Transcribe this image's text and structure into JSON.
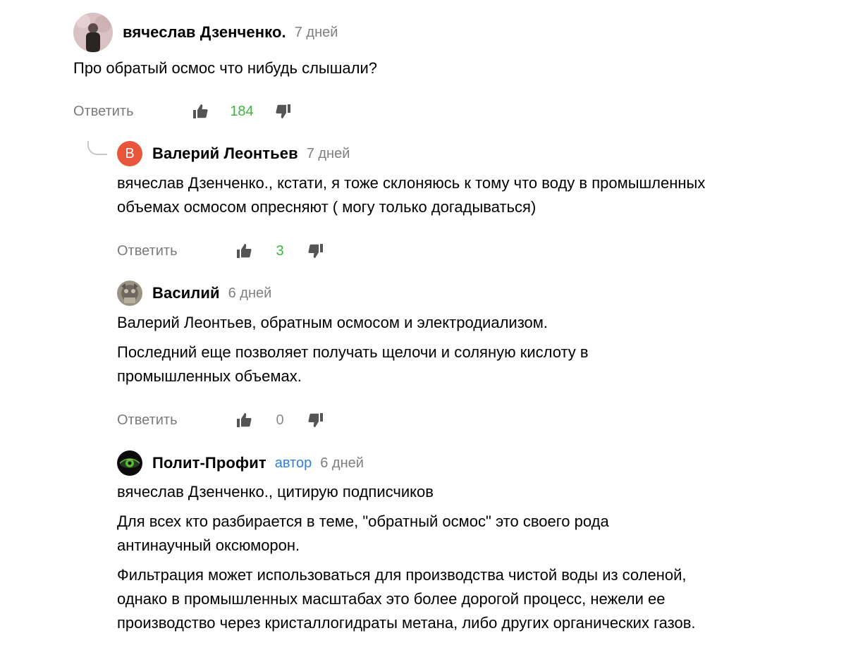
{
  "comments": [
    {
      "name": "вячеслав Дзенченко.",
      "date": "7 дней",
      "paragraphs": [
        "Про обратый осмос что нибудь слышали?"
      ],
      "reply_label": "Ответить",
      "likes": "184",
      "avatar_icon": "user-photo-icon"
    },
    {
      "name": "Валерий Леонтьев",
      "date": "7 дней",
      "avatar_letter": "В",
      "paragraphs": [
        "вячеслав Дзенченко., кстати, я тоже склоняюсь к тому что воду в промышленных объемах осмосом опресняют ( могу только догадываться)"
      ],
      "reply_label": "Ответить",
      "likes": "3"
    },
    {
      "name": "Василий",
      "date": "6 дней",
      "paragraphs": [
        "Валерий Леонтьев, обратным осмосом и электродиализом.",
        "Последний еще позволяет получать щелочи и соляную кислоту в промышленных объемах."
      ],
      "reply_label": "Ответить",
      "likes": "0",
      "avatar_icon": "cat-photo-icon"
    },
    {
      "name": "Полит-Профит",
      "badge": "автор",
      "date": "6 дней",
      "paragraphs": [
        "вячеслав Дзенченко., цитирую подписчиков",
        "Для всех кто разбирается в теме, \"обратный осмос\" это своего рода антинаучный оксюморон.",
        "Фильтрация может использоваться для производства чистой воды из соленой, однако в промышленных масштабах это более дорогой процесс, нежели ее производство через кристаллогидраты метана, либо других органических газов."
      ],
      "avatar_icon": "eye-logo-icon"
    }
  ],
  "colors": {
    "like_positive": "#3fb53f",
    "author_badge": "#2f7fd8",
    "letter_avatar_bg": "#e8553a"
  }
}
